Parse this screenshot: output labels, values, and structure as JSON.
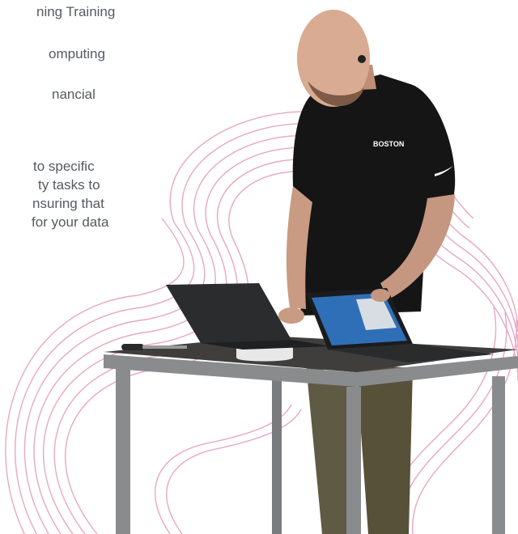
{
  "text": {
    "item_1": "ning Training",
    "item_2": "omputing",
    "item_3": "nancial",
    "paragraph": [
      "to specific",
      "ty tasks to",
      "nsuring that",
      "for your data"
    ]
  },
  "shirt_logo": "BOSTON",
  "colors": {
    "text": "#555a60",
    "swirl": "#e7a7c4",
    "shirt": "#151515",
    "pants": "#5e5a44",
    "table_top": "#3f3e3d",
    "table_frame": "#8a8b8c",
    "laptop_screen": "#2f6fb8"
  }
}
